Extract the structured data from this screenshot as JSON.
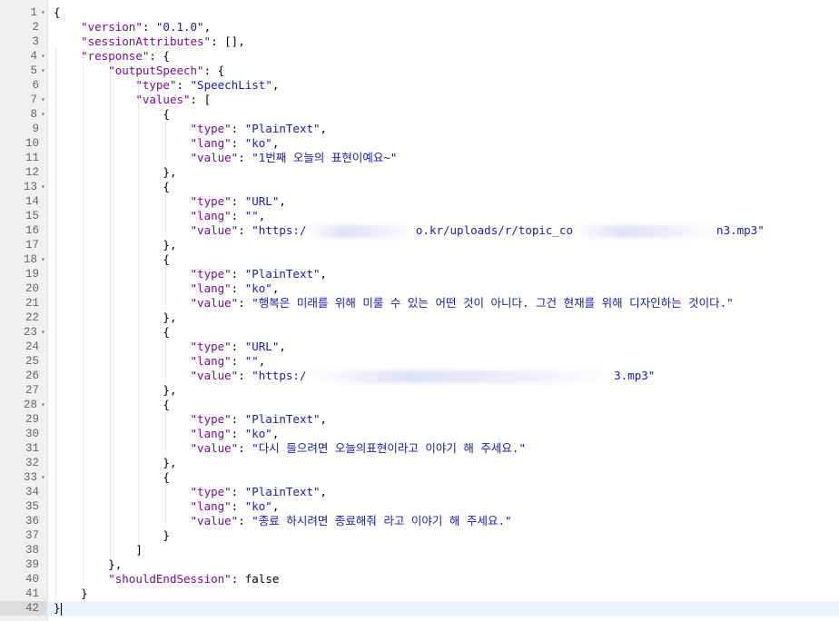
{
  "editor": {
    "lines": [
      {
        "n": "1",
        "fold": true,
        "parts": [
          [
            "p",
            "{"
          ]
        ]
      },
      {
        "n": "2",
        "parts": [
          [
            "i",
            "    "
          ],
          [
            "k",
            "\"version\""
          ],
          [
            "p",
            ": "
          ],
          [
            "s",
            "\"0.1.0\""
          ],
          [
            "p",
            ","
          ]
        ]
      },
      {
        "n": "3",
        "parts": [
          [
            "i",
            "    "
          ],
          [
            "k",
            "\"sessionAttributes\""
          ],
          [
            "p",
            ": [],"
          ]
        ]
      },
      {
        "n": "4",
        "fold": true,
        "parts": [
          [
            "i",
            "    "
          ],
          [
            "k",
            "\"response\""
          ],
          [
            "p",
            ": {"
          ]
        ]
      },
      {
        "n": "5",
        "fold": true,
        "parts": [
          [
            "i",
            "        "
          ],
          [
            "k",
            "\"outputSpeech\""
          ],
          [
            "p",
            ": {"
          ]
        ]
      },
      {
        "n": "6",
        "parts": [
          [
            "i",
            "            "
          ],
          [
            "k",
            "\"type\""
          ],
          [
            "p",
            ": "
          ],
          [
            "s",
            "\"SpeechList\""
          ],
          [
            "p",
            ","
          ]
        ]
      },
      {
        "n": "7",
        "fold": true,
        "parts": [
          [
            "i",
            "            "
          ],
          [
            "k",
            "\"values\""
          ],
          [
            "p",
            ": ["
          ]
        ]
      },
      {
        "n": "8",
        "fold": true,
        "parts": [
          [
            "i",
            "                "
          ],
          [
            "p",
            "{"
          ]
        ]
      },
      {
        "n": "9",
        "parts": [
          [
            "i",
            "                    "
          ],
          [
            "k",
            "\"type\""
          ],
          [
            "p",
            ": "
          ],
          [
            "s",
            "\"PlainText\""
          ],
          [
            "p",
            ","
          ]
        ]
      },
      {
        "n": "10",
        "parts": [
          [
            "i",
            "                    "
          ],
          [
            "k",
            "\"lang\""
          ],
          [
            "p",
            ": "
          ],
          [
            "s",
            "\"ko\""
          ],
          [
            "p",
            ","
          ]
        ]
      },
      {
        "n": "11",
        "parts": [
          [
            "i",
            "                    "
          ],
          [
            "k",
            "\"value\""
          ],
          [
            "p",
            ": "
          ],
          [
            "s",
            "\"1번째 오늘의 표현이예요~\""
          ]
        ]
      },
      {
        "n": "12",
        "parts": [
          [
            "i",
            "                "
          ],
          [
            "p",
            "},"
          ]
        ]
      },
      {
        "n": "13",
        "fold": true,
        "parts": [
          [
            "i",
            "                "
          ],
          [
            "p",
            "{"
          ]
        ]
      },
      {
        "n": "14",
        "parts": [
          [
            "i",
            "                    "
          ],
          [
            "k",
            "\"type\""
          ],
          [
            "p",
            ": "
          ],
          [
            "s",
            "\"URL\""
          ],
          [
            "p",
            ","
          ]
        ]
      },
      {
        "n": "15",
        "parts": [
          [
            "i",
            "                    "
          ],
          [
            "k",
            "\"lang\""
          ],
          [
            "p",
            ": "
          ],
          [
            "s",
            "\"\""
          ],
          [
            "p",
            ","
          ]
        ]
      },
      {
        "n": "16",
        "parts": [
          [
            "i",
            "                    "
          ],
          [
            "k",
            "\"value\""
          ],
          [
            "p",
            ": "
          ],
          [
            "s",
            "\"https:/"
          ],
          [
            "b",
            "                "
          ],
          [
            "s",
            "o.kr/uploads/r/topic_co"
          ],
          [
            "b",
            "                     "
          ],
          [
            "s",
            "n3.mp3\""
          ]
        ]
      },
      {
        "n": "17",
        "parts": [
          [
            "i",
            "                "
          ],
          [
            "p",
            "},"
          ]
        ]
      },
      {
        "n": "18",
        "fold": true,
        "parts": [
          [
            "i",
            "                "
          ],
          [
            "p",
            "{"
          ]
        ]
      },
      {
        "n": "19",
        "parts": [
          [
            "i",
            "                    "
          ],
          [
            "k",
            "\"type\""
          ],
          [
            "p",
            ": "
          ],
          [
            "s",
            "\"PlainText\""
          ],
          [
            "p",
            ","
          ]
        ]
      },
      {
        "n": "20",
        "parts": [
          [
            "i",
            "                    "
          ],
          [
            "k",
            "\"lang\""
          ],
          [
            "p",
            ": "
          ],
          [
            "s",
            "\"ko\""
          ],
          [
            "p",
            ","
          ]
        ]
      },
      {
        "n": "21",
        "parts": [
          [
            "i",
            "                    "
          ],
          [
            "k",
            "\"value\""
          ],
          [
            "p",
            ": "
          ],
          [
            "s",
            "\"행복은 미래를 위해 미룰 수 있는 어떤 것이 아니다. 그건 현재를 위해 디자인하는 것이다.\""
          ]
        ]
      },
      {
        "n": "22",
        "parts": [
          [
            "i",
            "                "
          ],
          [
            "p",
            "},"
          ]
        ]
      },
      {
        "n": "23",
        "fold": true,
        "parts": [
          [
            "i",
            "                "
          ],
          [
            "p",
            "{"
          ]
        ]
      },
      {
        "n": "24",
        "parts": [
          [
            "i",
            "                    "
          ],
          [
            "k",
            "\"type\""
          ],
          [
            "p",
            ": "
          ],
          [
            "s",
            "\"URL\""
          ],
          [
            "p",
            ","
          ]
        ]
      },
      {
        "n": "25",
        "parts": [
          [
            "i",
            "                    "
          ],
          [
            "k",
            "\"lang\""
          ],
          [
            "p",
            ": "
          ],
          [
            "s",
            "\"\""
          ],
          [
            "p",
            ","
          ]
        ]
      },
      {
        "n": "26",
        "parts": [
          [
            "i",
            "                    "
          ],
          [
            "k",
            "\"value\""
          ],
          [
            "p",
            ": "
          ],
          [
            "s",
            "\"https:/"
          ],
          [
            "b",
            "                                             "
          ],
          [
            "s",
            "3.mp3\""
          ]
        ]
      },
      {
        "n": "27",
        "parts": [
          [
            "i",
            "                "
          ],
          [
            "p",
            "},"
          ]
        ]
      },
      {
        "n": "28",
        "fold": true,
        "parts": [
          [
            "i",
            "                "
          ],
          [
            "p",
            "{"
          ]
        ]
      },
      {
        "n": "29",
        "parts": [
          [
            "i",
            "                    "
          ],
          [
            "k",
            "\"type\""
          ],
          [
            "p",
            ": "
          ],
          [
            "s",
            "\"PlainText\""
          ],
          [
            "p",
            ","
          ]
        ]
      },
      {
        "n": "30",
        "parts": [
          [
            "i",
            "                    "
          ],
          [
            "k",
            "\"lang\""
          ],
          [
            "p",
            ": "
          ],
          [
            "s",
            "\"ko\""
          ],
          [
            "p",
            ","
          ]
        ]
      },
      {
        "n": "31",
        "parts": [
          [
            "i",
            "                    "
          ],
          [
            "k",
            "\"value\""
          ],
          [
            "p",
            ": "
          ],
          [
            "s",
            "\"다시 들으려면 오늘의표현이라고 이야기 해 주세요.\""
          ]
        ]
      },
      {
        "n": "32",
        "parts": [
          [
            "i",
            "                "
          ],
          [
            "p",
            "},"
          ]
        ]
      },
      {
        "n": "33",
        "fold": true,
        "parts": [
          [
            "i",
            "                "
          ],
          [
            "p",
            "{"
          ]
        ]
      },
      {
        "n": "34",
        "parts": [
          [
            "i",
            "                    "
          ],
          [
            "k",
            "\"type\""
          ],
          [
            "p",
            ": "
          ],
          [
            "s",
            "\"PlainText\""
          ],
          [
            "p",
            ","
          ]
        ]
      },
      {
        "n": "35",
        "parts": [
          [
            "i",
            "                    "
          ],
          [
            "k",
            "\"lang\""
          ],
          [
            "p",
            ": "
          ],
          [
            "s",
            "\"ko\""
          ],
          [
            "p",
            ","
          ]
        ]
      },
      {
        "n": "36",
        "parts": [
          [
            "i",
            "                    "
          ],
          [
            "k",
            "\"value\""
          ],
          [
            "p",
            ": "
          ],
          [
            "s",
            "\"종료 하시려면 종료해줘 라고 이야기 해 주세요.\""
          ]
        ]
      },
      {
        "n": "37",
        "parts": [
          [
            "i",
            "                "
          ],
          [
            "p",
            "}"
          ]
        ]
      },
      {
        "n": "38",
        "parts": [
          [
            "i",
            "            "
          ],
          [
            "p",
            "]"
          ]
        ]
      },
      {
        "n": "39",
        "parts": [
          [
            "i",
            "        "
          ],
          [
            "p",
            "},"
          ]
        ]
      },
      {
        "n": "40",
        "parts": [
          [
            "i",
            "        "
          ],
          [
            "k",
            "\"shouldEndSession\""
          ],
          [
            "p",
            ": false"
          ]
        ]
      },
      {
        "n": "41",
        "parts": [
          [
            "i",
            "    "
          ],
          [
            "p",
            "}"
          ]
        ]
      },
      {
        "n": "42",
        "active": true,
        "parts": [
          [
            "p",
            "}"
          ],
          [
            "c",
            ""
          ]
        ]
      }
    ]
  },
  "colors": {
    "key": "#7a0a93",
    "string": "#1a1ab2",
    "gutter": "#f0f0f0",
    "active_line": "#eaf2fb"
  },
  "icons": {
    "fold": "triangle-down-icon"
  }
}
